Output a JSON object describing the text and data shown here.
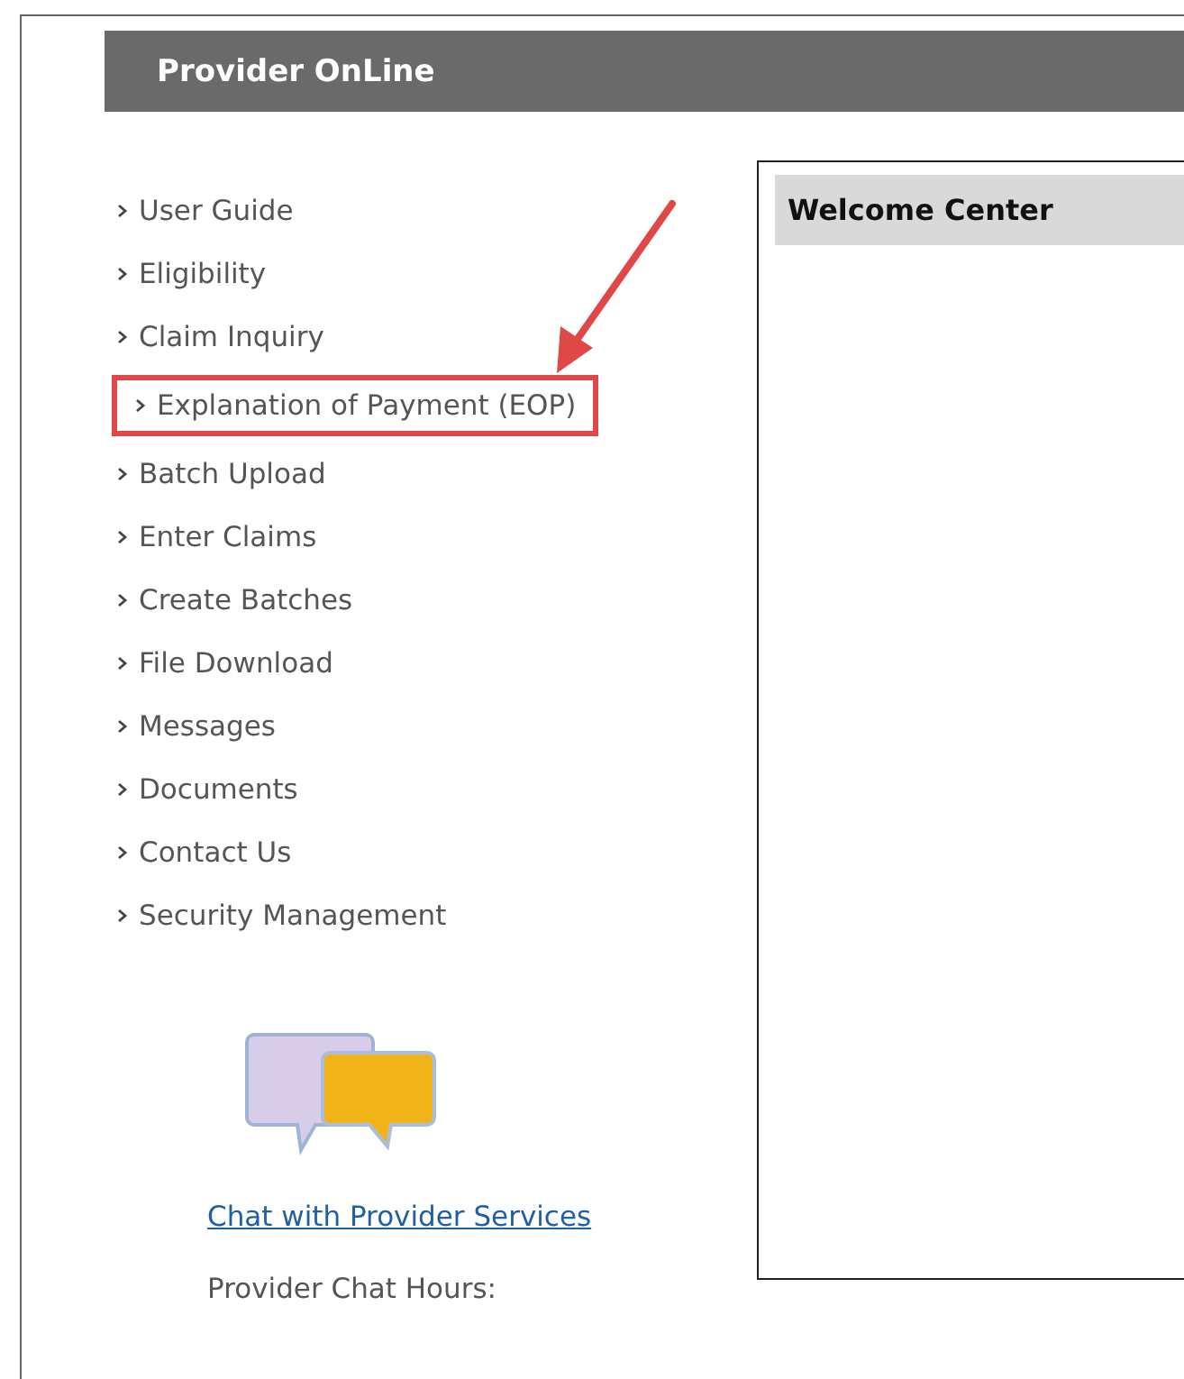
{
  "header": {
    "title": "Provider OnLine"
  },
  "menu": [
    {
      "label": "User Guide",
      "highlighted": false
    },
    {
      "label": "Eligibility",
      "highlighted": false
    },
    {
      "label": "Claim Inquiry",
      "highlighted": false
    },
    {
      "label": "Explanation of Payment (EOP)",
      "highlighted": true
    },
    {
      "label": "Batch Upload",
      "highlighted": false
    },
    {
      "label": "Enter Claims",
      "highlighted": false
    },
    {
      "label": "Create Batches",
      "highlighted": false
    },
    {
      "label": "File Download",
      "highlighted": false
    },
    {
      "label": "Messages",
      "highlighted": false
    },
    {
      "label": "Documents",
      "highlighted": false
    },
    {
      "label": "Contact Us",
      "highlighted": false
    },
    {
      "label": "Security Management",
      "highlighted": false
    }
  ],
  "chat": {
    "link": "Chat with Provider Services",
    "hours_label": "Provider Chat Hours:"
  },
  "welcome_panel": {
    "title": "Welcome Center"
  }
}
